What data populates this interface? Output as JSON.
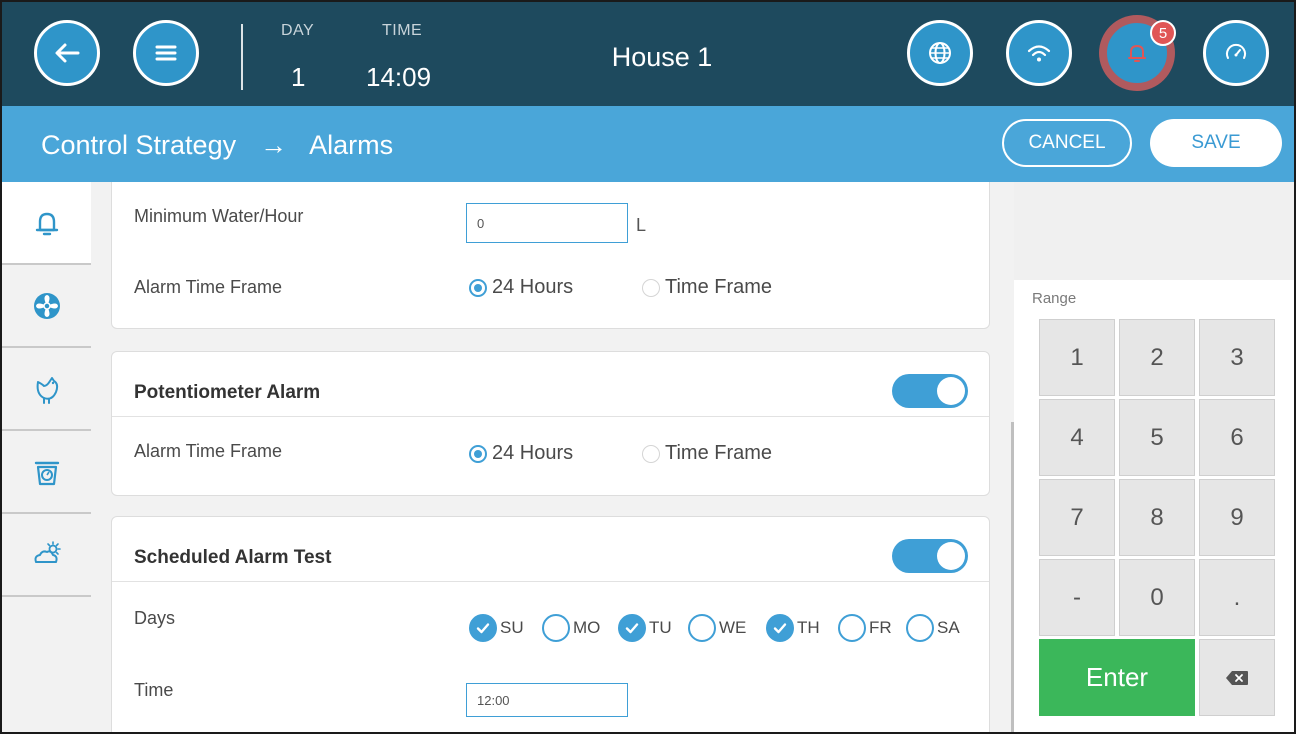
{
  "colors": {
    "topbar": "#1e4a5e",
    "header": "#4aa6d9",
    "button_blue": "#2f95c9",
    "accent": "#3f9fd6",
    "alarm_ring": "#b05a5e",
    "badge": "#e05656",
    "enter_green": "#3bb75a"
  },
  "topbar": {
    "day_label": "DAY",
    "day_value": "1",
    "time_label": "TIME",
    "time_value": "14:09",
    "house_title": "House 1",
    "alarm_count": "5",
    "icons": [
      "back-arrow-icon",
      "menu-icon",
      "globe-icon",
      "wifi-icon",
      "bell-icon",
      "gauge-icon"
    ]
  },
  "header": {
    "breadcrumb_parent": "Control Strategy",
    "breadcrumb_arrow": "→",
    "breadcrumb_current": "Alarms",
    "cancel_label": "CANCEL",
    "save_label": "SAVE"
  },
  "sidebar": {
    "items": [
      {
        "icon": "bell-icon",
        "active": true
      },
      {
        "icon": "fan-icon",
        "active": false
      },
      {
        "icon": "chicken-icon",
        "active": false
      },
      {
        "icon": "scale-icon",
        "active": false
      },
      {
        "icon": "weather-icon",
        "active": false
      }
    ]
  },
  "water_card": {
    "min_water_label": "Minimum Water/Hour",
    "min_water_value": "0",
    "min_water_unit": "L",
    "time_frame_label": "Alarm Time Frame",
    "option_24h": "24 Hours",
    "option_time_frame": "Time Frame",
    "selected": "24 Hours"
  },
  "potentiometer_card": {
    "title": "Potentiometer Alarm",
    "enabled": true,
    "time_frame_label": "Alarm Time Frame",
    "option_24h": "24 Hours",
    "option_time_frame": "Time Frame",
    "selected": "24 Hours"
  },
  "scheduled_card": {
    "title": "Scheduled Alarm Test",
    "enabled": true,
    "days_label": "Days",
    "days": [
      {
        "label": "SU",
        "checked": true
      },
      {
        "label": "MO",
        "checked": false
      },
      {
        "label": "TU",
        "checked": true
      },
      {
        "label": "WE",
        "checked": false
      },
      {
        "label": "TH",
        "checked": true
      },
      {
        "label": "FR",
        "checked": false
      },
      {
        "label": "SA",
        "checked": false
      }
    ],
    "time_label": "Time",
    "time_value": "12:00"
  },
  "keypad": {
    "range_label": "Range",
    "keys": [
      "1",
      "2",
      "3",
      "4",
      "5",
      "6",
      "7",
      "8",
      "9",
      "-",
      "0",
      "."
    ],
    "enter_label": "Enter",
    "backspace_icon": "backspace-icon"
  }
}
